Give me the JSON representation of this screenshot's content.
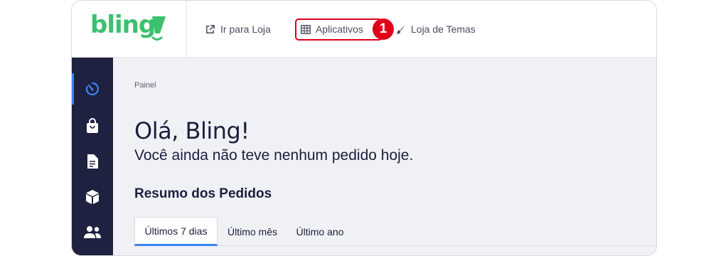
{
  "brand": {
    "logo_text": "bling",
    "accent": "#3ac16d"
  },
  "topnav": {
    "items": [
      {
        "label": "Ir para Loja",
        "icon": "external-link-icon"
      },
      {
        "label": "Aplicativos",
        "icon": "grid-table-icon"
      },
      {
        "label": "Loja de Temas",
        "icon": "paintbrush-icon"
      }
    ]
  },
  "annotation": {
    "step_number": "1",
    "color": "#e0001a"
  },
  "sidebar": {
    "items": [
      {
        "icon": "dashboard-timer-icon",
        "active": true
      },
      {
        "icon": "shopping-bag-icon"
      },
      {
        "icon": "document-icon"
      },
      {
        "icon": "box-icon"
      },
      {
        "icon": "users-icon"
      }
    ],
    "background": "#1f2140",
    "active_color": "#3b82f6"
  },
  "main": {
    "breadcrumb": "Painel",
    "greeting": "Olá, Bling!",
    "subtitle": "Você ainda não teve nenhum pedido hoje.",
    "section_title": "Resumo dos Pedidos",
    "tabs": [
      {
        "label": "Últimos 7 dias",
        "active": true
      },
      {
        "label": "Último mês"
      },
      {
        "label": "Último ano"
      }
    ]
  }
}
